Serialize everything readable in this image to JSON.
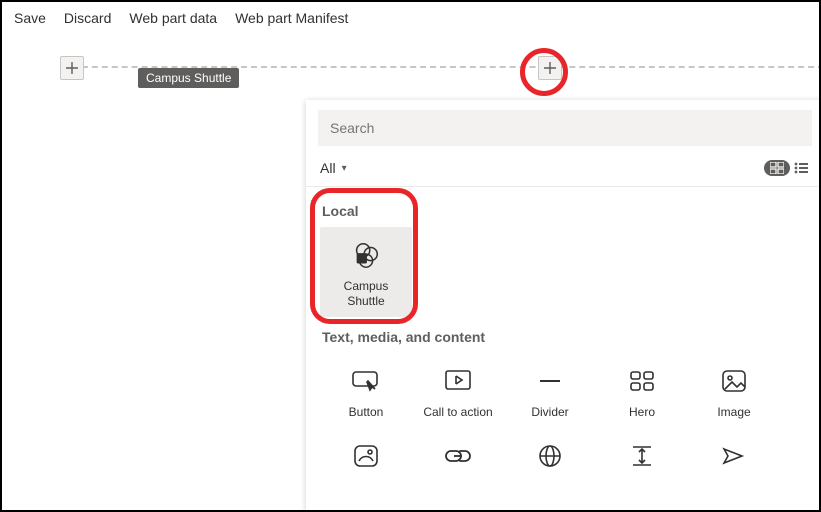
{
  "toolbar": {
    "save": "Save",
    "discard": "Discard",
    "webpart_data": "Web part data",
    "webpart_manifest": "Web part Manifest"
  },
  "tooltip": "Campus Shuttle",
  "picker": {
    "search_placeholder": "Search",
    "filter_label": "All",
    "sections": {
      "local": {
        "title": "Local",
        "items": [
          {
            "label": "Campus Shuttle"
          }
        ]
      },
      "text_media": {
        "title": "Text, media, and content",
        "row1": [
          {
            "label": "Button"
          },
          {
            "label": "Call to action"
          },
          {
            "label": "Divider"
          },
          {
            "label": "Hero"
          },
          {
            "label": "Image"
          }
        ],
        "row2": [
          {
            "label": ""
          },
          {
            "label": ""
          },
          {
            "label": ""
          },
          {
            "label": ""
          },
          {
            "label": ""
          }
        ]
      }
    }
  }
}
